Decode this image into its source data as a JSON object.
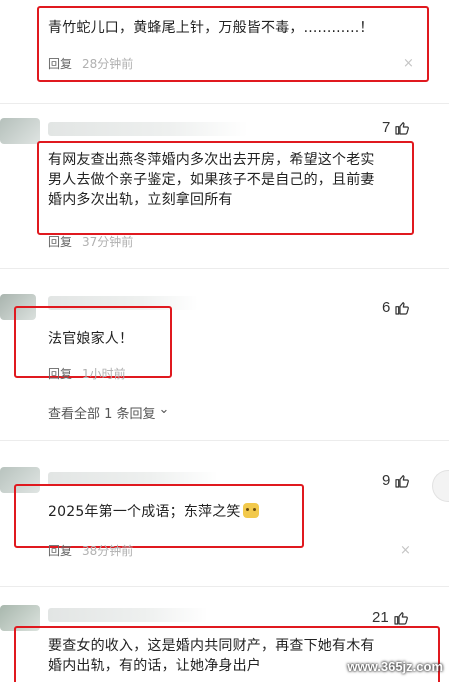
{
  "comments": [
    {
      "text": "青竹蛇儿口，黄蜂尾上针，万般皆不毒，............！",
      "reply_label": "回复",
      "time": "28分钟前",
      "close_glyph": "×"
    },
    {
      "likes": "7",
      "text_line1": "有网友查出燕冬萍婚内多次出去开房，希望这个老实",
      "text_line2": "男人去做个亲子鉴定，如果孩子不是自己的，且前妻",
      "text_line3": "婚内多次出轨，立刻拿回所有",
      "reply_label": "回复",
      "time": "37分钟前"
    },
    {
      "likes": "6",
      "text": "法官娘家人！",
      "reply_label": "回复",
      "time": "1小时前",
      "more_replies": "查看全部 1 条回复",
      "more_replies_chevron": "⌄"
    },
    {
      "likes": "9",
      "text": "2025年第一个成语；东萍之笑",
      "reply_label": "回复",
      "time": "38分钟前",
      "close_glyph": "×"
    },
    {
      "likes": "21",
      "text_line1": "要查女的收入，这是婚内共同财产，再查下她有木有",
      "text_line2": "婚内出轨，有的话，让她净身出户"
    }
  ],
  "watermark": "www.365jz.com",
  "colors": {
    "highlight_box": "#e0191f",
    "meta_text": "#8a8a8a",
    "divider": "#ececec"
  },
  "icons": {
    "like": "thumbs-up-icon",
    "close": "close-icon",
    "chevron": "chevron-down-icon"
  }
}
